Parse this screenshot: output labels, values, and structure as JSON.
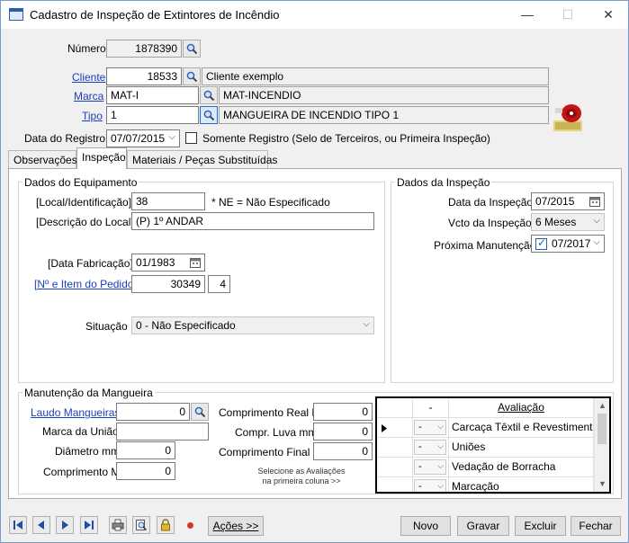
{
  "window": {
    "title": "Cadastro de Inspeção de Extintores de Incêndio",
    "minimize": "—",
    "maximize": "☐",
    "close": "✕"
  },
  "header": {
    "numero_label": "Número",
    "numero_value": "1878390",
    "cliente_label": "Cliente",
    "cliente_code": "18533",
    "cliente_name": "Cliente exemplo",
    "marca_label": "Marca",
    "marca_code": "MAT-I",
    "marca_name": "MAT-INCENDIO",
    "tipo_label": "Tipo",
    "tipo_code": "1",
    "tipo_name": "MANGUEIRA DE INCENDIO TIPO 1",
    "data_registro_label": "Data do Registro",
    "data_registro_value": "07/07/2015",
    "somente_registro_label": "Somente Registro (Selo de Terceiros, ou Primeira Inspeção)"
  },
  "tabs": [
    {
      "label": "Observações"
    },
    {
      "label": "Inspeção"
    },
    {
      "label": "Materiais / Peças Substituídas"
    }
  ],
  "equipamento": {
    "group_title": "Dados do Equipamento",
    "local_label": "[Local/Identificação]",
    "local_value": "38",
    "ne_note": "* NE = Não Especificado",
    "descricao_label": "[Descrição do Local]",
    "descricao_value": "(P) 1º ANDAR",
    "data_fab_label": "[Data Fabricação]",
    "data_fab_value": "01/1983",
    "pedido_label": "[Nº e Item do Pedido]",
    "pedido_value": "30349",
    "pedido_item": "4",
    "situacao_label": "Situação",
    "situacao_value": "0 - Não Especificado"
  },
  "inspecao": {
    "group_title": "Dados da Inspeção",
    "data_label": "Data da Inspeção",
    "data_value": "07/2015",
    "vcto_label": "Vcto da Inspeção",
    "vcto_value": "6 Meses",
    "proxima_label": "Próxima Manutenção",
    "proxima_value": "07/2017"
  },
  "mangueira": {
    "group_title": "Manutenção da Mangueira",
    "laudo_label": "Laudo Mangueiras",
    "laudo_value": "0",
    "marca_uniao_label": "Marca da União",
    "marca_uniao_value": "",
    "diametro_label": "Diâmetro mm",
    "diametro_value": "0",
    "comprimento_label": "Comprimento M",
    "comprimento_value": "0",
    "comp_real_label": "Comprimento Real M",
    "comp_real_value": "0",
    "comp_luva_label": "Compr. Luva mm",
    "comp_luva_value": "0",
    "comp_final_label": "Comprimento Final M",
    "comp_final_value": "0",
    "hint": "Selecione as Avaliações na primeira coluna >>"
  },
  "avaliacao_grid": {
    "col1_header": "-",
    "col2_header": "Avaliação",
    "rows": [
      {
        "sel": "-",
        "name": "Carcaça Têxtil e Revestimento",
        "current": true
      },
      {
        "sel": "-",
        "name": "Uniões",
        "current": false
      },
      {
        "sel": "-",
        "name": "Vedação de Borracha",
        "current": false
      },
      {
        "sel": "-",
        "name": "Marcação",
        "current": false
      }
    ]
  },
  "footer": {
    "acoes_label": "Ações >>",
    "novo_label": "Novo",
    "gravar_label": "Gravar",
    "excluir_label": "Excluir",
    "fechar_label": "Fechar"
  }
}
